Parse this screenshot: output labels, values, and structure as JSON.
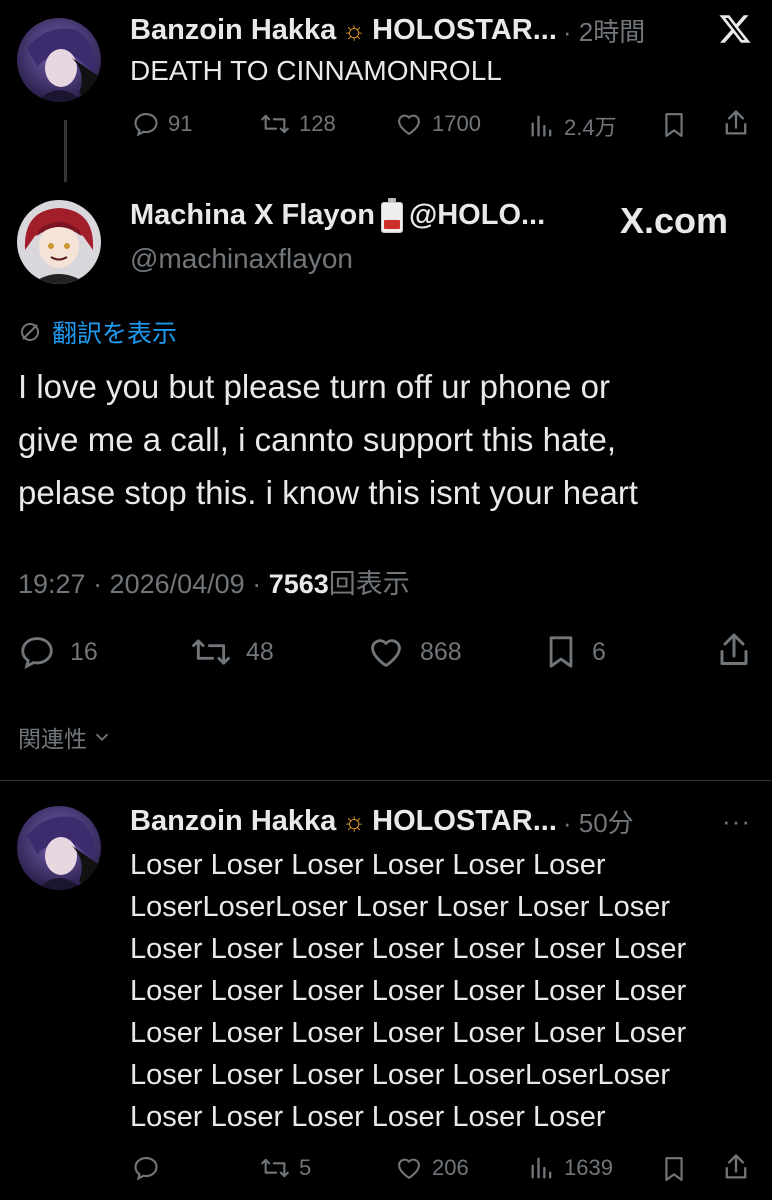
{
  "tweet1": {
    "display_name": "Banzoin Hakka",
    "name_suffix": "HOLOSTAR...",
    "time": "· 2時間",
    "text": "DEATH TO CINNAMONROLL",
    "actions": {
      "replies": "91",
      "reposts": "128",
      "likes": "1700",
      "views": "2.4万"
    }
  },
  "main_tweet": {
    "display_name": "Machina X Flayon",
    "handle_inline": "@HOLO...",
    "handle": "@machinaxflayon",
    "watermark": "X.com",
    "translate_label": "翻訳を表示",
    "text_lines": [
      "I love you but please turn off ur phone or",
      "give me a call, i cannto support this hate,",
      "pelase stop this. i know this isnt your heart"
    ],
    "meta": {
      "time": "19:27 · 2026/04/09 · ",
      "views": "7563",
      "views_label": "回表示"
    },
    "actions": {
      "replies": "16",
      "reposts": "48",
      "likes": "868",
      "bookmarks": "6"
    }
  },
  "related_label": "関連性",
  "tweet2": {
    "display_name": "Banzoin Hakka",
    "name_suffix": "HOLOSTAR...",
    "time": "· 50分",
    "text_lines": [
      "Loser Loser Loser Loser Loser Loser",
      "LoserLoserLoser Loser Loser Loser Loser",
      "Loser Loser Loser Loser Loser Loser Loser",
      "Loser Loser Loser Loser Loser Loser Loser",
      "Loser Loser Loser Loser Loser Loser Loser",
      "Loser Loser Loser Loser LoserLoserLoser",
      "Loser Loser Loser Loser Loser Loser"
    ],
    "actions": {
      "reposts": "5",
      "likes": "206",
      "views": "1639"
    }
  },
  "colors": {
    "background": "#000000",
    "text": "#e7e9ea",
    "muted": "#71767b",
    "link": "#1d9bf0"
  }
}
